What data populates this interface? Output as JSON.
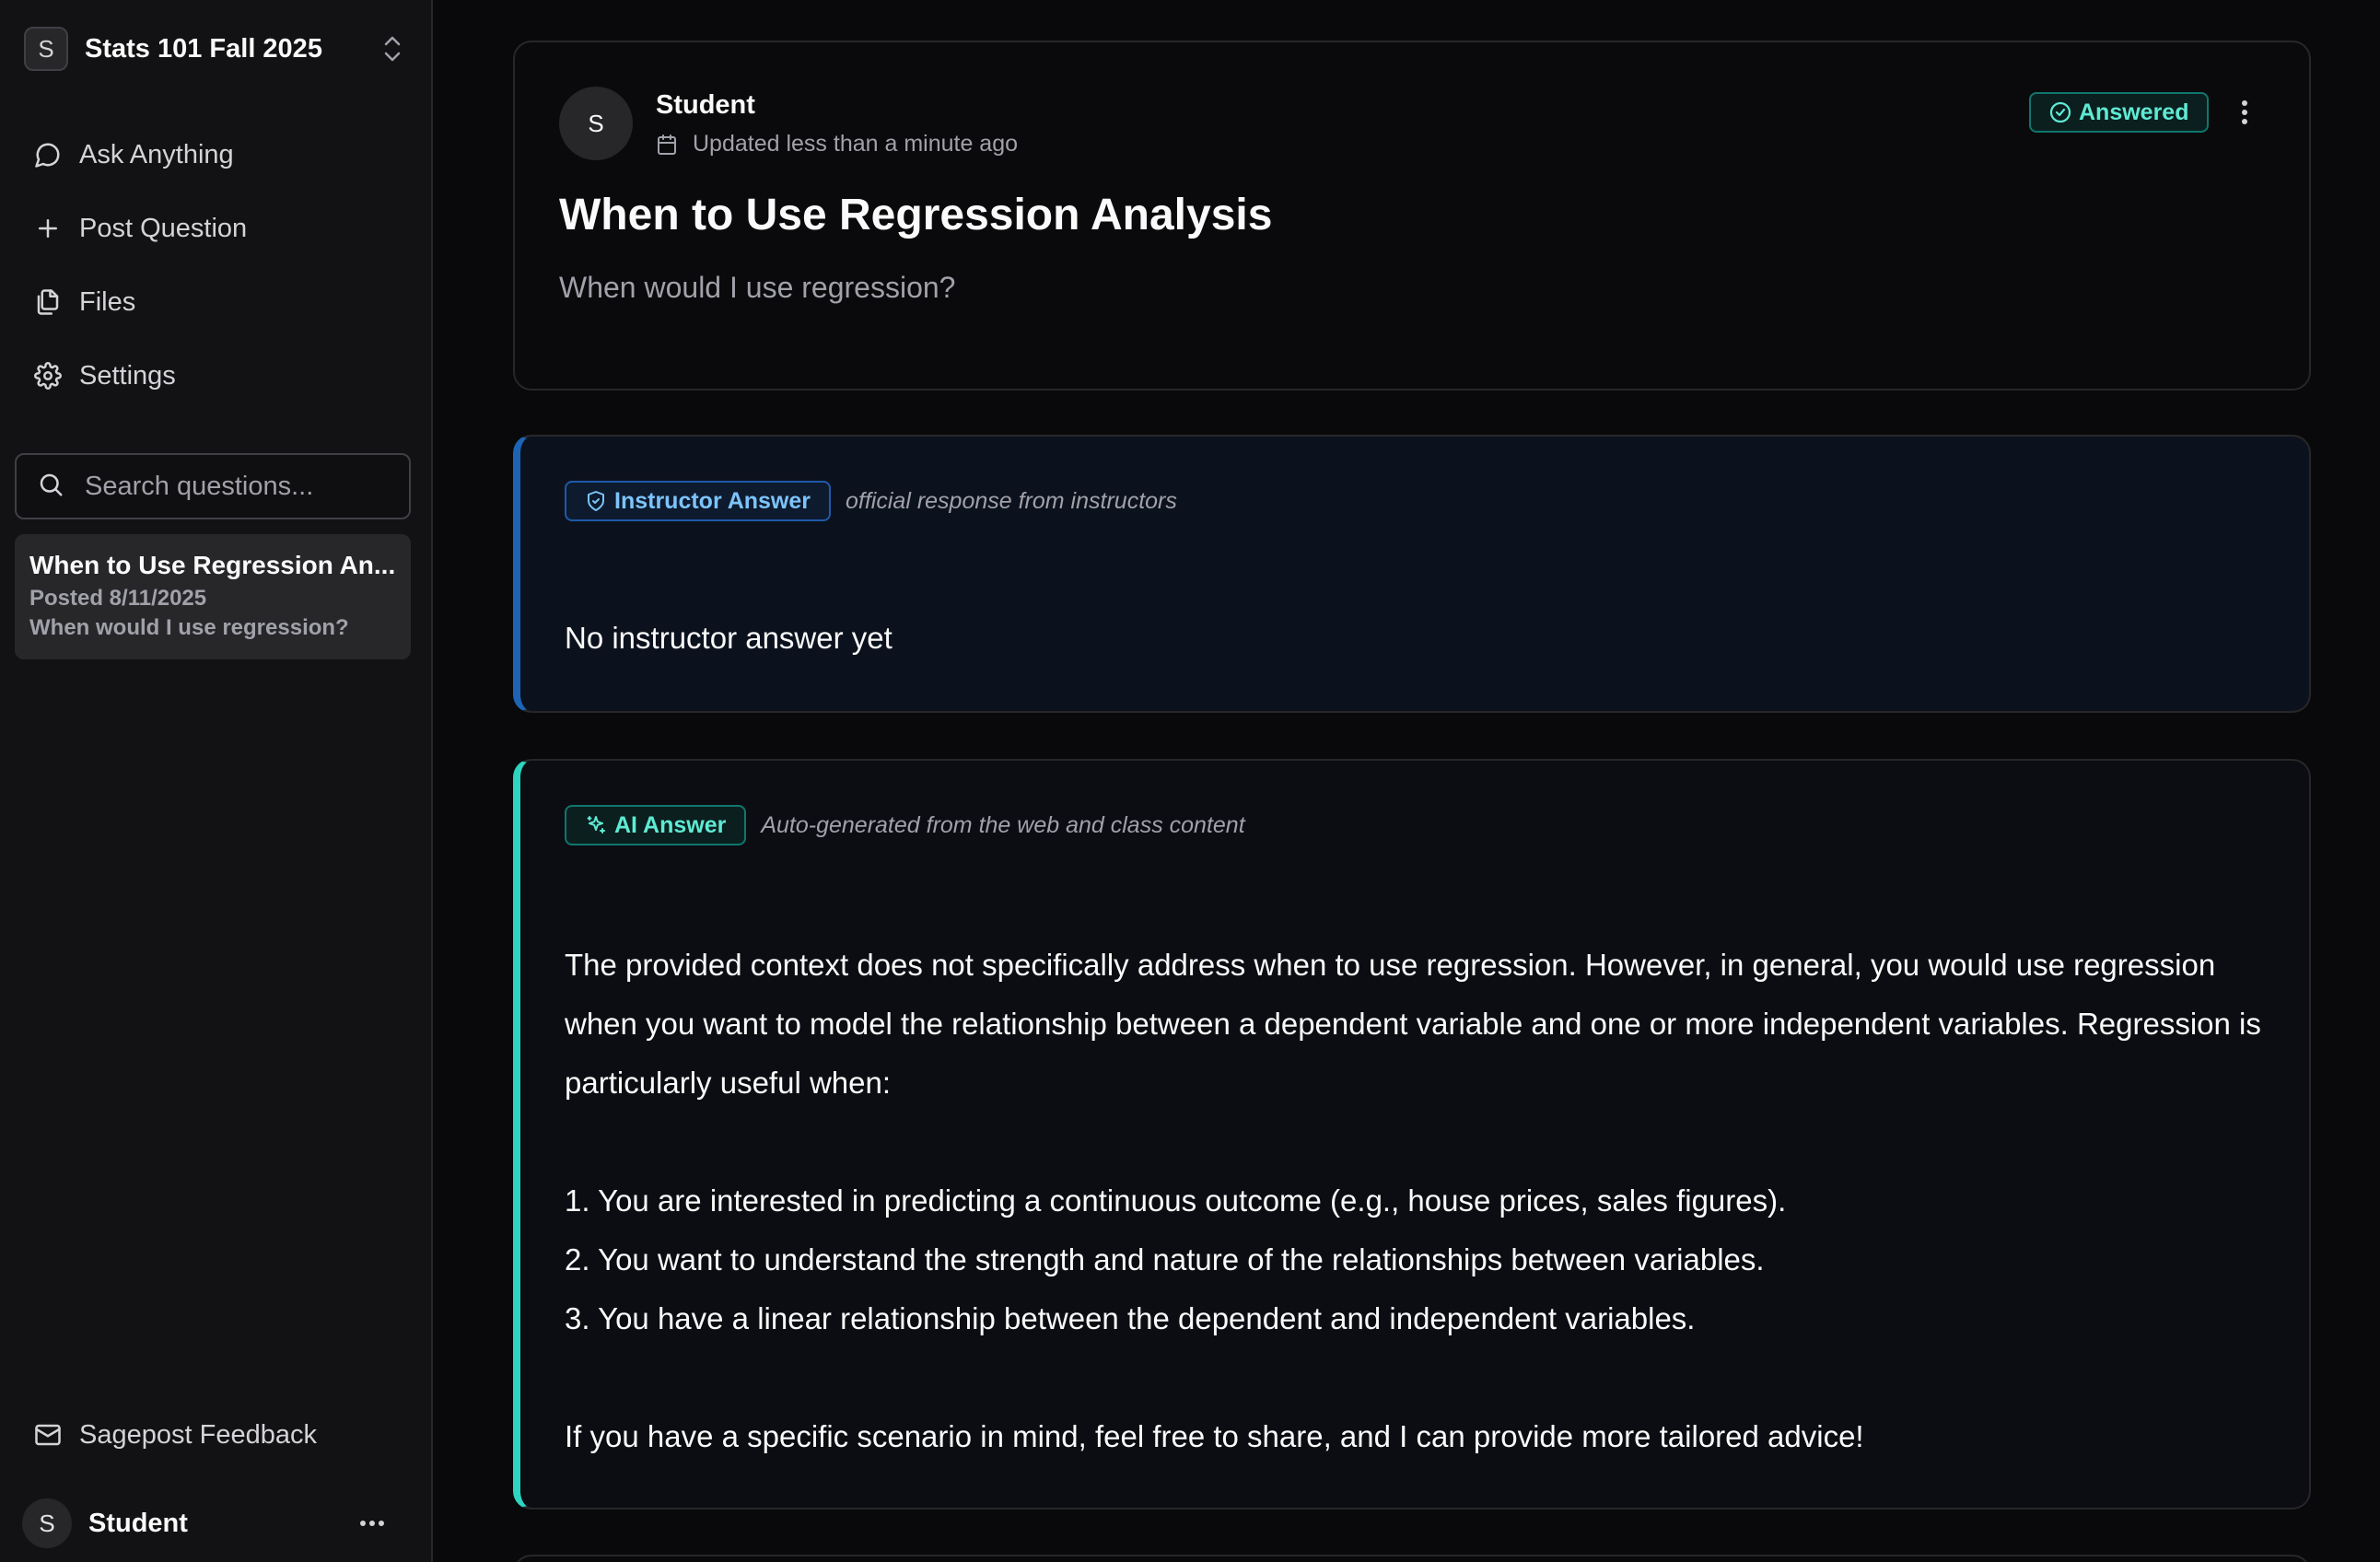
{
  "sidebar": {
    "course_initial": "S",
    "course_name": "Stats 101 Fall 2025",
    "nav": [
      {
        "label": "Ask Anything",
        "icon": "chat-bubble-icon"
      },
      {
        "label": "Post Question",
        "icon": "plus-icon"
      },
      {
        "label": "Files",
        "icon": "files-icon"
      },
      {
        "label": "Settings",
        "icon": "gear-icon"
      }
    ],
    "search_placeholder": "Search questions...",
    "questions": [
      {
        "title": "When to Use Regression An...",
        "posted": "Posted 8/11/2025",
        "preview": "When would I use regression?"
      }
    ],
    "feedback_label": "Sagepost Feedback",
    "user_initial": "S",
    "user_name": "Student"
  },
  "question": {
    "author_initial": "S",
    "author": "Student",
    "updated": "Updated less than a minute ago",
    "status": "Answered",
    "title": "When to Use Regression Analysis",
    "body": "When would I use regression?"
  },
  "instructor_answer": {
    "tag": "Instructor Answer",
    "note": "official response from instructors",
    "body": "No instructor answer yet"
  },
  "ai_answer": {
    "tag": "AI Answer",
    "note": "Auto-generated from the web and class content",
    "intro": "The provided context does not specifically address when to use regression. However, in general, you would use regression when you want to model the relationship between a dependent variable and one or more independent variables. Regression is particularly useful when:",
    "points": [
      "1. You are interested in predicting a continuous outcome (e.g., house prices, sales figures).",
      "2. You want to understand the strength and nature of the relationships between variables.",
      "3. You have a linear relationship between the dependent and independent variables."
    ],
    "closing": "If you have a specific scenario in mind, feel free to share, and I can provide more tailored advice!"
  },
  "colors": {
    "background": "#09090b",
    "instructor_accent": "#1d64b5",
    "ai_accent": "#2dd4bf",
    "answered_badge": "#5eead4"
  }
}
